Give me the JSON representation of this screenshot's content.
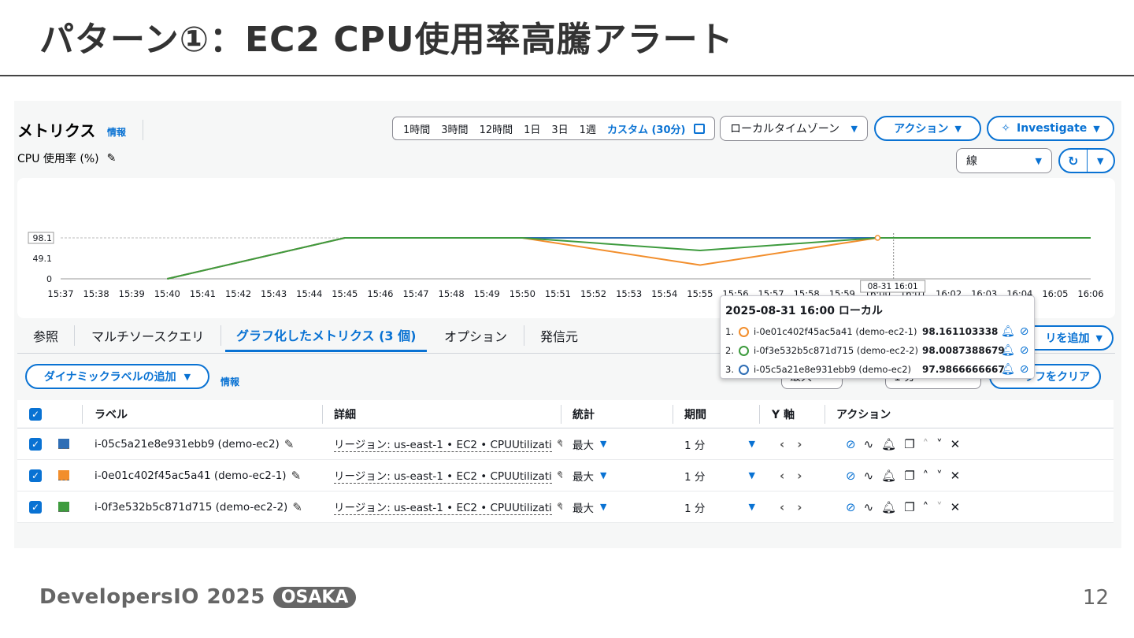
{
  "slide": {
    "title": "パターン①：EC2 CPU使用率高騰アラート",
    "page_number": "12",
    "footer_brand": "DevelopersIO 2025",
    "footer_badge": "OSAKA"
  },
  "header": {
    "title": "メトリクス",
    "info": "情報",
    "metric_label": "CPU 使用率 (%)",
    "time_ranges": [
      "1時間",
      "3時間",
      "12時間",
      "1日",
      "3日",
      "1週",
      "カスタム (30分)"
    ],
    "timezone": "ローカルタイムゾーン",
    "actions_button": "アクション",
    "investigate_button": "Investigate",
    "graph_type": "線"
  },
  "tabs": [
    "参照",
    "マルチソースクエリ",
    "グラフ化したメトリクス (3 個)",
    "オプション",
    "発信元"
  ],
  "toolbar": {
    "dynamic_label_button": "ダイナミックラベルの追加",
    "info": "情報",
    "stat_value": "最大",
    "period_value": "1 分",
    "add_query_button": "リを追加",
    "clear_button": "ラフをクリア"
  },
  "chart_data": {
    "type": "line",
    "x": [
      "15:37",
      "15:38",
      "15:39",
      "15:40",
      "15:41",
      "15:42",
      "15:43",
      "15:44",
      "15:45",
      "15:46",
      "15:47",
      "15:48",
      "15:49",
      "15:50",
      "15:51",
      "15:52",
      "15:53",
      "15:54",
      "15:55",
      "15:56",
      "15:57",
      "15:58",
      "15:59",
      "16:00",
      "16:01",
      "16:02",
      "16:03",
      "16:04",
      "16:05",
      "16:06"
    ],
    "yticks": [
      "0",
      "49.1",
      "98.1"
    ],
    "ylim": [
      0,
      98.1
    ],
    "crosshair_label": "08-31 16:01",
    "series": [
      {
        "color": "#2f6eb5",
        "points": [
          [
            3,
            0
          ],
          [
            8,
            98.1
          ],
          [
            29,
            98.1
          ]
        ]
      },
      {
        "color": "#f28e2c",
        "points": [
          [
            3,
            0
          ],
          [
            8,
            98.1
          ],
          [
            13,
            98.1
          ],
          [
            18,
            33
          ],
          [
            23,
            98.1
          ]
        ]
      },
      {
        "color": "#3e9b3e",
        "points": [
          [
            3,
            0
          ],
          [
            8,
            98.1
          ],
          [
            13,
            98.1
          ],
          [
            18,
            68
          ],
          [
            23,
            98.1
          ],
          [
            29,
            98.1
          ]
        ]
      }
    ],
    "marker": {
      "x": 23,
      "y": 98.1
    }
  },
  "tooltip": {
    "title": "2025-08-31 16:00 ローカル",
    "rows": [
      {
        "num": "1.",
        "name": "i-0e01c402f45ac5a41 (demo-ec2-1)",
        "value": "98.161103338",
        "color": "#f28e2c"
      },
      {
        "num": "2.",
        "name": "i-0f3e532b5c871d715 (demo-ec2-2)",
        "value": "98.0087388679",
        "color": "#3e9b3e"
      },
      {
        "num": "3.",
        "name": "i-05c5a21e8e931ebb9 (demo-ec2)",
        "value": "97.9866666667",
        "color": "#2f6eb5"
      }
    ]
  },
  "table": {
    "headers": {
      "label": "ラベル",
      "detail": "詳細",
      "stat": "統計",
      "period": "期間",
      "yaxis": "Y 軸",
      "actions": "アクション"
    },
    "rows": [
      {
        "label": "i-05c5a21e8e931ebb9 (demo-ec2)",
        "color": "#2f6eb5",
        "detail": "リージョン: us-east-1 • EC2 • CPUUtilizati",
        "stat": "最大",
        "period": "1 分"
      },
      {
        "label": "i-0e01c402f45ac5a41 (demo-ec2-1)",
        "color": "#f28e2c",
        "detail": "リージョン: us-east-1 • EC2 • CPUUtilizati",
        "stat": "最大",
        "period": "1 分"
      },
      {
        "label": "i-0f3e532b5c871d715 (demo-ec2-2)",
        "color": "#3e9b3e",
        "detail": "リージョン: us-east-1 • EC2 • CPUUtilizati",
        "stat": "最大",
        "period": "1 分"
      }
    ]
  }
}
